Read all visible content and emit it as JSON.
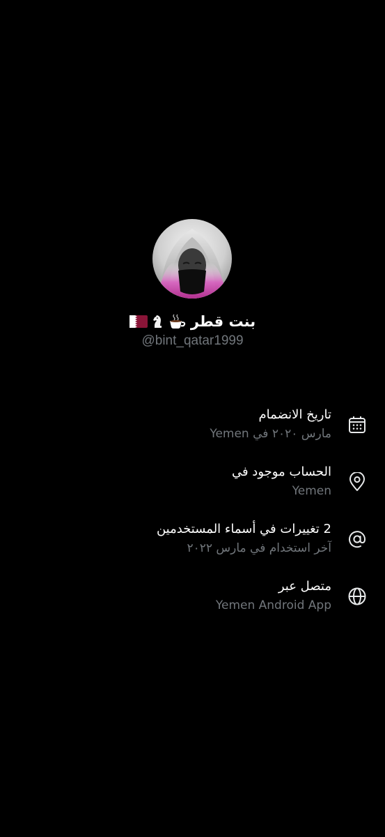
{
  "profile": {
    "display_name": "بنت قطر",
    "name_emojis": [
      "qatar-flag-icon",
      "chess-knight-icon",
      "hot-beverage-icon"
    ],
    "handle": "@bint_qatar1999"
  },
  "info": [
    {
      "icon": "calendar-icon",
      "title": "تاريخ الانضمام",
      "subtitle": "مارس ٢٠٢٠ في Yemen"
    },
    {
      "icon": "location-pin-icon",
      "title": "الحساب موجود في",
      "subtitle": "Yemen"
    },
    {
      "icon": "at-sign-icon",
      "title": "2 تغييرات في أسماء المستخدمين",
      "subtitle": "آخر استخدام في مارس ٢٠٢٢"
    },
    {
      "icon": "globe-icon",
      "title": "متصل عبر",
      "subtitle": "Yemen Android App"
    }
  ],
  "colors": {
    "background": "#000000",
    "primary_text": "#ffffff",
    "secondary_text": "#71767b",
    "avatar_accent": "#c2309e",
    "flag_maroon": "#8a1538"
  }
}
